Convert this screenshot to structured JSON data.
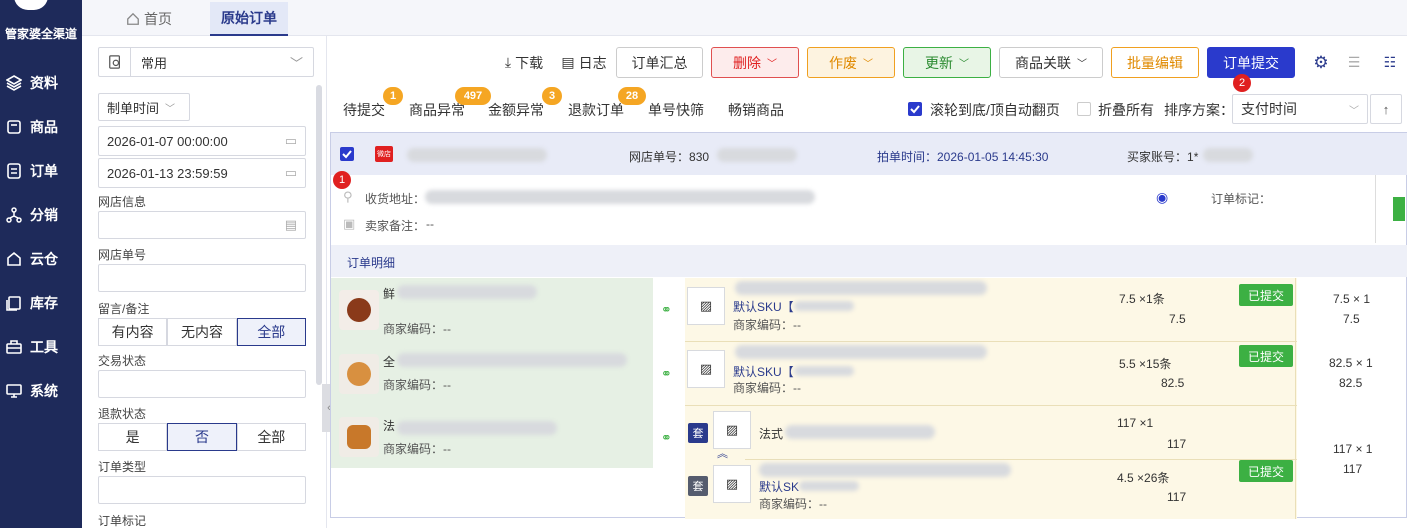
{
  "nav": {
    "brand": "管家婆全渠道",
    "items": [
      {
        "label": "资料",
        "icon": "layers-icon"
      },
      {
        "label": "商品",
        "icon": "box-icon"
      },
      {
        "label": "订单",
        "icon": "list-icon"
      },
      {
        "label": "分销",
        "icon": "share-icon"
      },
      {
        "label": "云仓",
        "icon": "cloud-warehouse-icon"
      },
      {
        "label": "库存",
        "icon": "stock-icon"
      },
      {
        "label": "工具",
        "icon": "toolbox-icon"
      },
      {
        "label": "系统",
        "icon": "monitor-icon"
      }
    ]
  },
  "tabs": [
    {
      "label": "首页",
      "icon": "home-icon"
    },
    {
      "label": "原始订单"
    }
  ],
  "filter": {
    "scheme": "常用",
    "time_type": "制单时间",
    "start": "2026-01-07 00:00:00",
    "end": "2026-01-13 23:59:59",
    "shop_info_label": "网店信息",
    "shop_no_label": "网店单号",
    "remark_label": "留言/备注",
    "remark_opts": [
      "有内容",
      "无内容",
      "全部"
    ],
    "trade_status_label": "交易状态",
    "refund_label": "退款状态",
    "refund_opts": [
      "是",
      "否",
      "全部"
    ],
    "order_type_label": "订单类型",
    "order_mark_label": "订单标记"
  },
  "toolbar": {
    "download": "下载",
    "log": "日志",
    "summary": "订单汇总",
    "delete": "删除",
    "void": "作废",
    "update": "更新",
    "link": "商品关联",
    "batch_edit": "批量编辑",
    "submit": "订单提交"
  },
  "quick_tabs": [
    {
      "label": "待提交",
      "badge": "1"
    },
    {
      "label": "商品异常",
      "badge": "497"
    },
    {
      "label": "金额异常",
      "badge": "3"
    },
    {
      "label": "退款订单",
      "badge": "28"
    },
    {
      "label": "单号快筛",
      "badge": ""
    },
    {
      "label": "畅销商品",
      "badge": ""
    }
  ],
  "options": {
    "auto_page": "滚轮到底/顶自动翻页",
    "auto_page_checked": true,
    "fold_all": "折叠所有",
    "fold_checked": false,
    "sort_label": "排序方案：",
    "sort_value": "支付时间",
    "red_badge_1": "1",
    "red_badge_2": "2"
  },
  "order": {
    "shop_tag": "微店",
    "shop_no_label": "网店单号：",
    "shop_no_partial": "830",
    "paid_time": "拍单时间：2026-01-05 14:45:30",
    "buyer_label": "买家账号：",
    "buyer_partial": "1*",
    "address_label": "收货地址：",
    "seller_note_label": "卖家备注：",
    "seller_note": "--",
    "order_mark_label": "订单标记：",
    "detail_title": "订单明细",
    "left_items": [
      {
        "name_partial": "鲜",
        "code": "商家编码：--"
      },
      {
        "name_partial": "全",
        "code": "商家编码：--"
      },
      {
        "name_partial": "法",
        "code": "商家编码：--"
      }
    ],
    "right_items": [
      {
        "sku": "默认SKU【",
        "sku_suffix": "sgl004】",
        "code": "商家编码：--",
        "qty": "7.5 ×1条",
        "amount": "7.5",
        "status": "已提交",
        "total_qty": "7.5 × 1",
        "total": "7.5"
      },
      {
        "sku": "默认SKU【",
        "sku_suffix": "sgl003】",
        "code": "商家编码：--",
        "qty": "5.5 ×15条",
        "amount": "82.5",
        "status": "已提交",
        "total_qty": "82.5 × 1",
        "total": "82.5"
      },
      {
        "tag": "套",
        "name_partial": "法式",
        "qty": "117 ×1",
        "amount": "117",
        "total_qty": "117 × 1",
        "total": "117"
      },
      {
        "tag": "套",
        "sku": "默认SK",
        "code": "商家编码：--",
        "qty": "4.5 ×26条",
        "amount": "117",
        "status": "已提交"
      }
    ]
  },
  "colors": {
    "nav": "#1e2a5a",
    "primary": "#2a3a8c",
    "success": "#3cb043",
    "warning": "#f5a623",
    "danger": "#e02020"
  }
}
